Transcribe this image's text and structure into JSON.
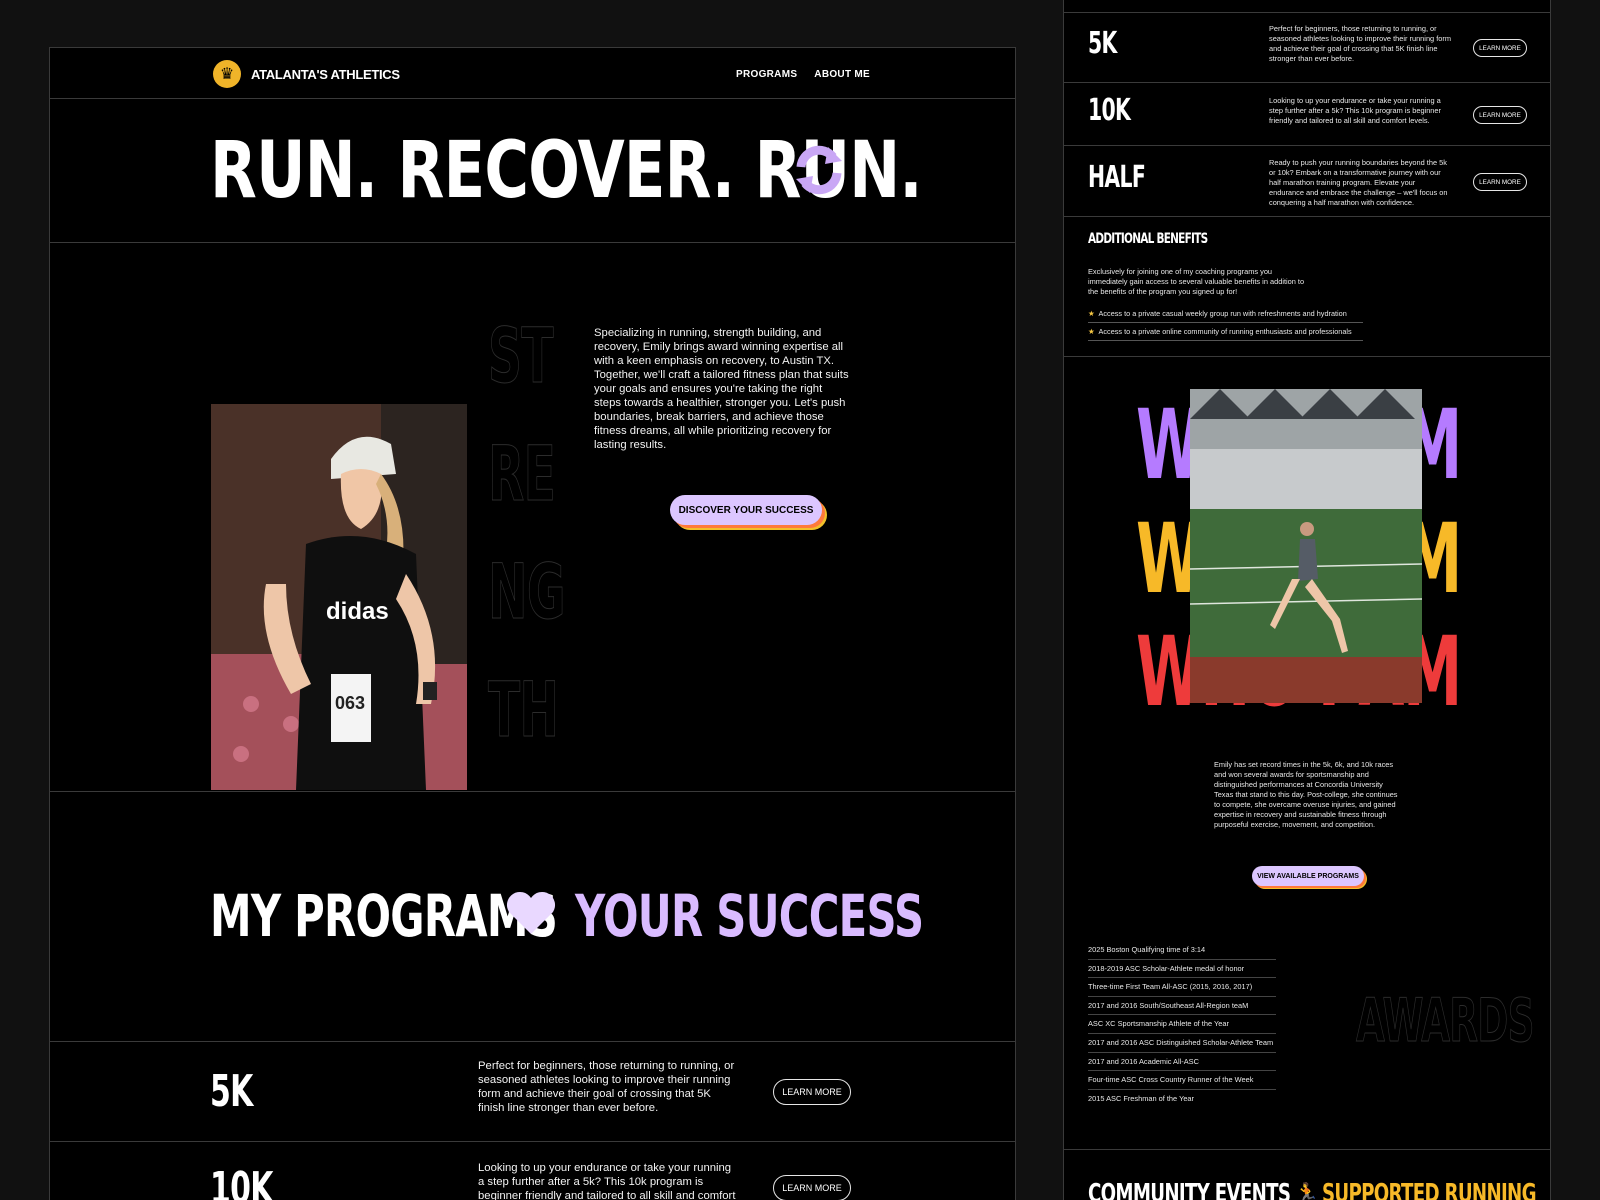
{
  "brand": {
    "name": "ATALANTA'S ATHLETICS",
    "logo_icon": "lion-icon"
  },
  "nav": {
    "items": [
      "PROGRAMS",
      "ABOUT ME"
    ]
  },
  "hero": {
    "title": "RUN. RECOVER. RUN.",
    "icon": "refresh-icon",
    "icon_color": "#c9a7f5"
  },
  "strength": {
    "letters": [
      "ST",
      "RE",
      "NG",
      "TH"
    ]
  },
  "intro": {
    "text": "Specializing in running, strength building, and recovery, Emily brings award winning expertise all with a keen emphasis on recovery, to Austin TX. Together, we'll craft a tailored fitness plan that suits your goals and ensures you're taking the right steps towards a healthier, stronger you. Let's push boundaries, break barriers, and achieve those fitness dreams, all while prioritizing recovery for lasting results.",
    "cta": "DISCOVER YOUR SUCCESS"
  },
  "programs_heading": {
    "part1": "MY PROGRAMS",
    "icon": "heart-icon",
    "part2": "YOUR SUCCESS",
    "accent": "#d9bbff"
  },
  "programs": [
    {
      "name": "5K",
      "desc": "Perfect for beginners, those returning to running, or seasoned athletes looking to improve their running form and achieve their goal of crossing that 5K finish line stronger than ever before.",
      "button": "LEARN MORE"
    },
    {
      "name": "10K",
      "desc": "Looking to up your endurance or take your running a step further after a 5k? This 10k program is beginner friendly and tailored to all skill and comfort levels.",
      "button": "LEARN MORE"
    },
    {
      "name": "HALF",
      "desc": "Ready to push your running boundaries beyond the 5k or 10k? Embark on a transformative journey with our half marathon training program. Elevate your endurance and embrace the challenge – we'll focus on conquering a half marathon with confidence.",
      "button": "LEARN MORE"
    }
  ],
  "benefits": {
    "title": "ADDITIONAL BENEFITS",
    "intro": "Exclusively for joining one of my coaching programs you immediately gain access to several valuable benefits in addition to the benefits of the program you signed up for!",
    "items": [
      "Access to a private casual weekly group run with refreshments and hydration",
      "Access to a private online community of running enthusiasts and professionals"
    ]
  },
  "who": {
    "title": "WHO I AM",
    "colors": [
      "#b57bff",
      "#f7b928",
      "#ee3b3b"
    ],
    "bio": "Emily has set record times in the 5k, 6k, and 10k races and won several awards for sportsmanship and distinguished performances at Concordia University Texas that stand to this day. Post-college, she continues to compete, she overcame overuse injuries, and gained expertise in recovery and sustainable fitness through purposeful exercise, movement, and competition.",
    "cta": "VIEW AVAILABLE PROGRAMS"
  },
  "awards": {
    "title": "AWARDS",
    "items": [
      "2025 Boston Qualifying time of 3:14",
      "2018-2019 ASC Scholar-Athlete medal of honor",
      "Three-time First Team All-ASC (2015, 2016, 2017)",
      "2017 and 2016 South/Southeast All-Region teaM",
      "ASC XC Sportsmanship Athlete of the Year",
      "2017 and 2016 ASC Distinguished Scholar-Athlete Team",
      "2017 and 2016 Academic All-ASC",
      "Four-time ASC Cross Country Runner of the Week",
      "2015 ASC Freshman of the Year"
    ]
  },
  "community": {
    "part1": "COMMUNITY EVENTS",
    "icon": "runner-icon",
    "part2": "SUPPORTED RUNNING",
    "accent": "#f7b928"
  }
}
